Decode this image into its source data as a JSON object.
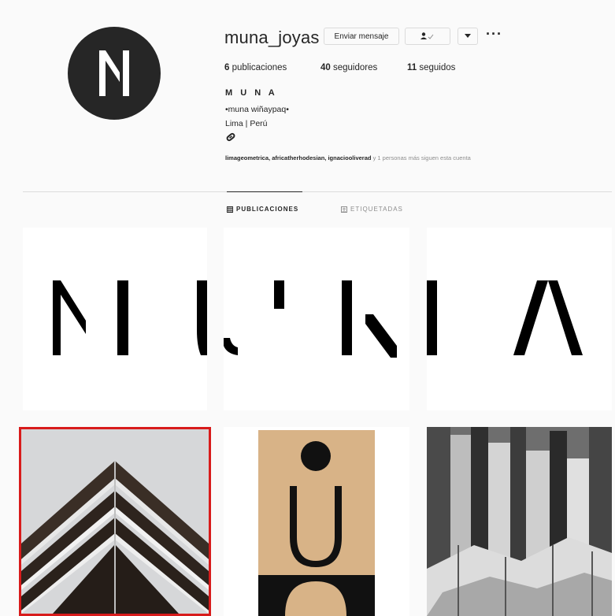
{
  "profile": {
    "username": "muna_joyas",
    "message_button": "Enviar mensaje",
    "follow_status_icon": "user-check-icon",
    "dropdown_icon": "chevron-down-icon",
    "more_icon": "ellipsis-icon",
    "stats": {
      "posts_count": "6",
      "posts_label": "publicaciones",
      "followers_count": "40",
      "followers_label": "seguidores",
      "following_count": "11",
      "following_label": "seguidos"
    },
    "full_name": "M U N A",
    "bio_line1": "•muna wiñaypaq•",
    "bio_line2": "Lima | Perú",
    "link_icon": "paperclip-icon",
    "followed_by_names": "limageometrica, africatherhodesian, ignaciooliverad",
    "followed_by_suffix": "y 1 personas más siguen esta cuenta"
  },
  "tabs": [
    {
      "label": "PUBLICACIONES",
      "icon": "grid-icon",
      "active": true
    },
    {
      "label": "ETIQUETADAS",
      "icon": "tag-icon",
      "active": false
    }
  ],
  "posts": [
    {
      "desc": "M letter"
    },
    {
      "desc": "U letter"
    },
    {
      "desc": "N letter"
    },
    {
      "desc": "A letter"
    },
    {
      "desc": "architecture",
      "selected": true
    },
    {
      "desc": "poster"
    },
    {
      "desc": "basalt columns"
    }
  ],
  "colors": {
    "accent_border": "#d81b1b",
    "text": "#262626",
    "muted": "#8e8e8e"
  }
}
